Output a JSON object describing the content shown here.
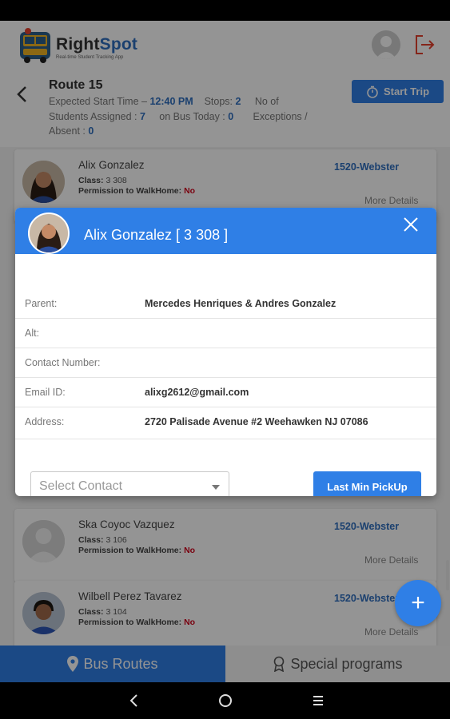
{
  "header": {
    "brand_prefix": "Right",
    "brand_suffix": "Spot",
    "tagline": "Real-time Student Tracking App"
  },
  "route": {
    "title": "Route 15",
    "expected_label": "Expected Start Time – ",
    "expected_value": "12:40 PM",
    "stops_label": "Stops: ",
    "stops_value": "2",
    "exceptions_label": "No of",
    "assigned_label": "Students Assigned : ",
    "assigned_value": "7",
    "onbus_label": "on Bus Today : ",
    "onbus_value": "0",
    "exceptions_label2": "Exceptions /",
    "absent_label": "Absent : ",
    "absent_value": "0",
    "start_trip_label": "Start Trip"
  },
  "students": [
    {
      "name": "Alix Gonzalez",
      "class_label": "Class:",
      "class_value": "3 308",
      "walk_label": "Permission to WalkHome:",
      "walk_value": "No",
      "school": "1520-Webster",
      "more": "More Details"
    },
    {
      "name": "Ska Coyoc Vazquez",
      "class_label": "Class:",
      "class_value": "3 106",
      "walk_label": "Permission to WalkHome:",
      "walk_value": "No",
      "school": "1520-Webster",
      "more": "More Details"
    },
    {
      "name": "Wilbell Perez Tavarez",
      "class_label": "Class:",
      "class_value": "3 104",
      "walk_label": "Permission to WalkHome:",
      "walk_value": "No",
      "school": "1520-Webster",
      "more": "More Details"
    }
  ],
  "modal": {
    "title": "Alix Gonzalez [ 3 308 ]",
    "rows": [
      {
        "label": "Parent:",
        "value": "Mercedes Henriques & Andres Gonzalez"
      },
      {
        "label": "Alt:",
        "value": ""
      },
      {
        "label": "Contact Number:",
        "value": ""
      },
      {
        "label": "Email ID:",
        "value": "alixg2612@gmail.com"
      },
      {
        "label": "Address:",
        "value": "2720 Palisade Avenue #2 Weehawken NJ 07086"
      }
    ],
    "select_placeholder": "Select Contact",
    "pickup_label": "Last Min PickUp"
  },
  "tabs": {
    "bus_routes": "Bus Routes",
    "special_programs": "Special programs"
  },
  "fab_label": "+",
  "colors": {
    "accent": "#2f7fe6",
    "link": "#2f6fbf",
    "negative": "#d0021b"
  }
}
